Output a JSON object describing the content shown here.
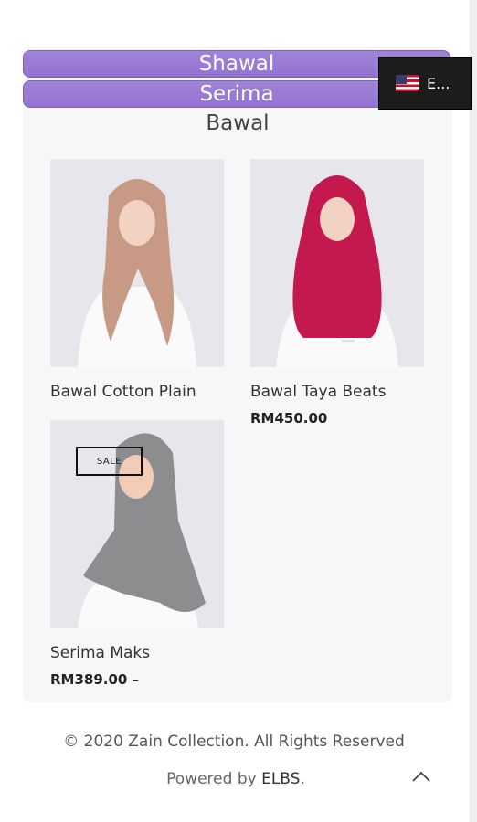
{
  "categories": {
    "tabs": [
      {
        "label": "Shawal"
      },
      {
        "label": "Serima"
      }
    ],
    "current": "Bawal"
  },
  "language": {
    "label": "E...",
    "flag_icon": "us-flag-icon"
  },
  "products": [
    {
      "name": "Bawal Cotton Plain",
      "price": "",
      "hijab_color": "#c89a86"
    },
    {
      "name": "Bawal Taya Beats",
      "price": "RM450.00",
      "hijab_color": "#c3194f"
    },
    {
      "name": "Serima Maks",
      "price": "RM389.00 –",
      "badge": "SALE",
      "hijab_color": "#8d8d90"
    }
  ],
  "footer": {
    "copyright": "© 2020 Zain Collection. All Rights Reserved",
    "powered_prefix": "Powered by ",
    "powered_brand": "ELBS",
    "powered_suffix": ".",
    "scroll_top_icon": "chevron-up-icon"
  },
  "colors": {
    "tab_purple": "#9a7ad4",
    "sale_badge_border": "#111111"
  }
}
